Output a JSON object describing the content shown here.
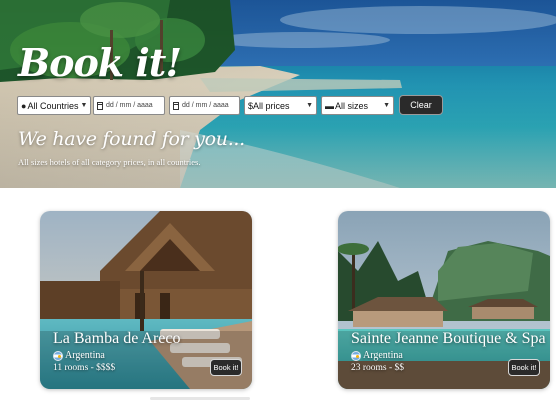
{
  "header": {
    "brand": "Book it!",
    "filters": {
      "country": "All Countries",
      "date_from_placeholder": "dd / mm / aaaa",
      "date_to_placeholder": "dd / mm / aaaa",
      "price": "$All prices",
      "size": "All sizes",
      "clear_label": "Clear"
    },
    "results_title": "We have found for you...",
    "results_summary": "All sizes hotels of all category prices, in all countries."
  },
  "hotels": [
    {
      "name": "La Bamba de Areco",
      "country": "Argentina",
      "rooms": "11 rooms - $$$$",
      "book_label": "Book it!"
    },
    {
      "name": "Sainte Jeanne Boutique & Spa",
      "country": "Argentina",
      "rooms": "23 rooms - $$",
      "book_label": "Book it!"
    }
  ],
  "colors": {
    "button_bg": "#2a2a2a",
    "button_text": "#ffffff",
    "sea": "#3fb8c8",
    "sky": "#2d6fb8"
  },
  "icons": {
    "country": "map-marker-icon",
    "date_from": "calendar-in-icon",
    "date_to": "calendar-out-icon",
    "price": "dollar-icon",
    "size": "bed-icon",
    "flag": "argentina-flag-icon"
  }
}
